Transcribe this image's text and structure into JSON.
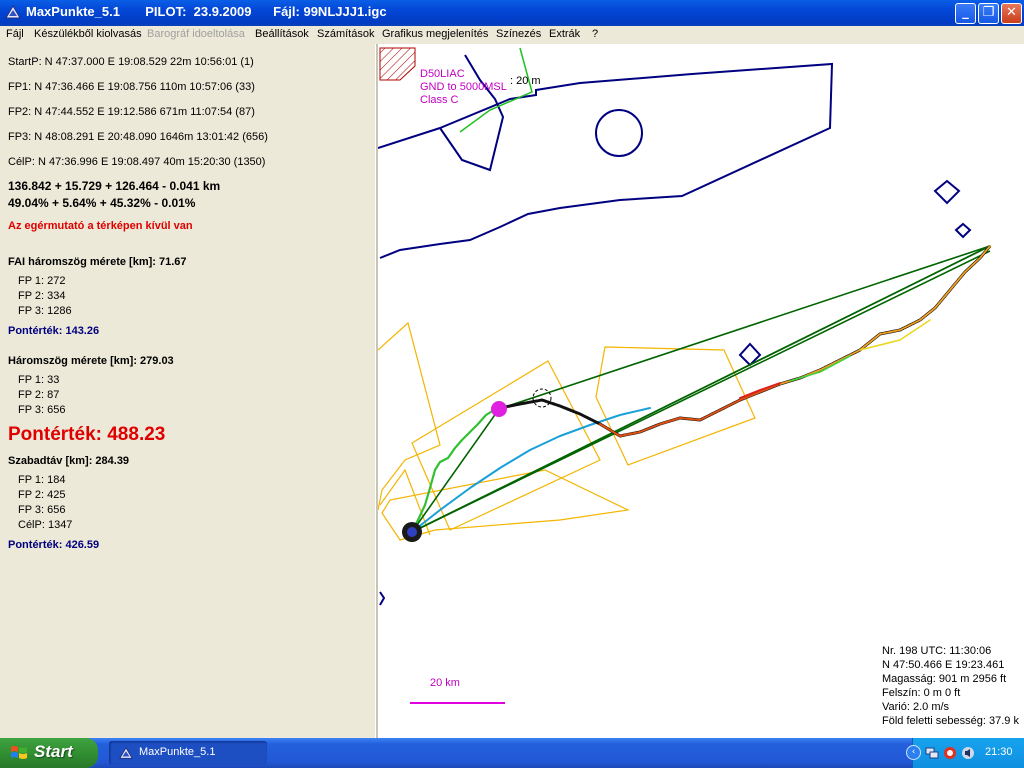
{
  "window": {
    "app_name": "MaxPunkte_5.1",
    "pilot": "PILOT:  23.9.2009",
    "file": "Fájl: 99NLJJJ1.igc",
    "buttons": {
      "minimize": "_",
      "maximize": "❐",
      "close": "✕"
    }
  },
  "menu": [
    "Fájl",
    "Készülékből kiolvasás",
    "Barográf idoeltolása",
    "Beállítások",
    "Számítások",
    "Grafikus megjelenítés",
    "Színezés",
    "Extrák",
    "?"
  ],
  "panel": {
    "points": [
      "StartP:  N 47:37.000  E 19:08.529  22m  10:56:01  (1)",
      "FP1:  N 47:36.466  E 19:08.756  110m  10:57:06  (33)",
      "FP2:  N 47:44.552  E 19:12.586  671m  11:07:54  (87)",
      "FP3:  N 48:08.291  E 20:48.090  1646m  13:01:42  (656)",
      "CélP:  N 47:36.996  E 19:08.497  40m  15:20:30  (1350)"
    ],
    "sum_km": "136.842 + 15.729 + 126.464 - 0.041 km",
    "sum_pct": "49.04% + 5.64% + 45.32% - 0.01%",
    "mouse_status": "Az egérmutató a térképen kívül van",
    "fai": {
      "title": "FAI háromszög mérete [km]: 71.67",
      "fps": [
        "FP 1: 272",
        "FP 2: 334",
        "FP 3: 1286"
      ],
      "score": "Pontérték: 143.26"
    },
    "triangle": {
      "title": "Háromszög mérete [km]: 279.03",
      "fps": [
        "FP 1: 33",
        "FP 2: 87",
        "FP 3: 656"
      ],
      "score": "Pontérték: 488.23"
    },
    "free": {
      "title": "Szabadtáv [km]: 284.39",
      "fps": [
        "FP 1: 184",
        "FP 2: 425",
        "FP 3: 656",
        "CélP: 1347"
      ],
      "score": "Pontérték: 426.59"
    }
  },
  "map": {
    "airspace": [
      "D50LIAC",
      "GND to 5000MSL",
      "Class C"
    ],
    "alt_label": ": 20 m",
    "scale_label": "20 km",
    "colors": {
      "airspace": "#000080",
      "sectors": "#f4b400",
      "legs": "#006400",
      "scale": "#e000e0",
      "restricted": "#b00000"
    },
    "info": [
      "Nr. 198  UTC: 11:30:06",
      "N 47:50.466  E 19:23.461",
      "Magasság:  901 m  2956 ft",
      "Felszín: 0 m  0 ft",
      "Varió:  2.0 m/s",
      "Föld feletti sebesség:  37.9 k"
    ]
  },
  "taskbar": {
    "start": "Start",
    "app": "MaxPunkte_5.1",
    "clock": "21:30"
  }
}
